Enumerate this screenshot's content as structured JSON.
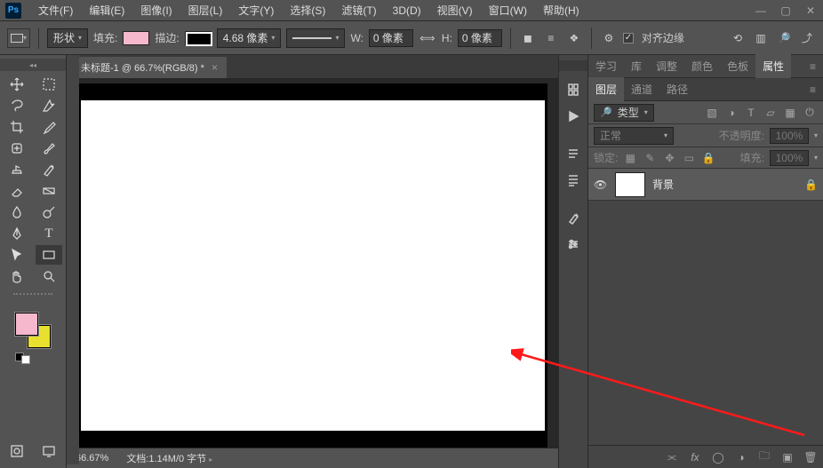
{
  "app": {
    "logo": "Ps"
  },
  "menu": [
    "文件(F)",
    "编辑(E)",
    "图像(I)",
    "图层(L)",
    "文字(Y)",
    "选择(S)",
    "滤镜(T)",
    "3D(D)",
    "视图(V)",
    "窗口(W)",
    "帮助(H)"
  ],
  "window_controls": {
    "min": "—",
    "max": "▢",
    "close": "✕"
  },
  "options": {
    "shape_mode": "形状",
    "fill_label": "填充:",
    "fill_color": "#f5b8cd",
    "stroke_label": "描边:",
    "stroke_width": "4.68 像素",
    "w_label": "W:",
    "w_value": "0 像素",
    "link_icon": "⟺",
    "h_label": "H:",
    "h_value": "0 像素",
    "align_label": "对齐边缘"
  },
  "document": {
    "tab_title": "未标题-1 @ 66.7%(RGB/8) *",
    "zoom": "66.67%",
    "doc_info": "文档:1.14M/0 字节"
  },
  "panel_group_top": [
    "学习",
    "库",
    "调整",
    "颜色",
    "色板",
    "属性"
  ],
  "panel_group_layers": [
    "图层",
    "通道",
    "路径"
  ],
  "layers": {
    "filter_label": "类型",
    "blend_mode": "正常",
    "opacity_label": "不透明度:",
    "opacity_value": "100%",
    "lock_label": "锁定:",
    "fill_label": "填充:",
    "fill_value": "100%",
    "items": [
      {
        "name": "背景",
        "locked": true
      }
    ]
  },
  "colors": {
    "foreground": "#f5b8cd",
    "background_swatch": "#e8df2e"
  }
}
